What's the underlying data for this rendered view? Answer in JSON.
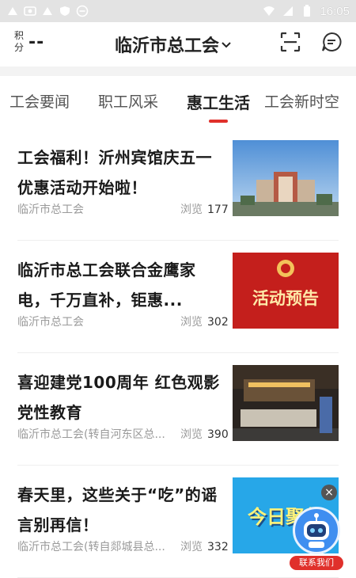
{
  "status_bar": {
    "time": "16:05"
  },
  "header": {
    "points_label": "积分",
    "points_value": "--",
    "city": "临沂市总工会"
  },
  "tabs": [
    "工会要闻",
    "职工风采",
    "惠工生活",
    "工会新时空"
  ],
  "active_tab": "惠工生活",
  "view_label": "浏览",
  "news": [
    {
      "title": "工会福利！沂州宾馆庆五一优惠活动开始啦！",
      "source": "临沂市总工会",
      "views": "177"
    },
    {
      "title": "临沂市总工会联合金鹰家电，千万直补，钜惠...",
      "source": "临沂市总工会",
      "views": "302",
      "thumb_text": "活动预告"
    },
    {
      "title": "喜迎建党100周年  红色观影党性教育",
      "source": "临沂市总工会(转自河东区总...",
      "views": "390"
    },
    {
      "title": "春天里，这些关于“吃”的谣言别再信！",
      "source": "临沂市总工会(转自郯城县总...",
      "views": "332",
      "thumb_text": "今日聚焦"
    }
  ],
  "float_contact": {
    "label": "联系我们",
    "close": "×"
  },
  "colors": {
    "accent": "#e0302b",
    "float_blue": "#3f8ef0"
  }
}
